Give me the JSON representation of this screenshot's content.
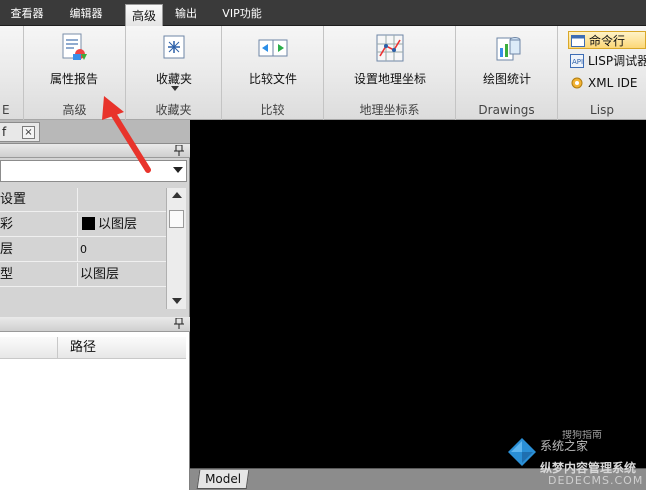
{
  "tabs": [
    {
      "label": "查看器",
      "active": false
    },
    {
      "label": "编辑器",
      "active": false
    },
    {
      "label": "高级",
      "active": true
    },
    {
      "label": "输出",
      "active": false
    },
    {
      "label": "VIP功能",
      "active": false
    }
  ],
  "ribbon": {
    "groups": [
      {
        "label": "高级",
        "buttons": [
          {
            "label": "属性报告",
            "icon": "property-report-icon"
          }
        ]
      },
      {
        "label": "收藏夹",
        "buttons": [
          {
            "label": "收藏夹",
            "icon": "favorites-icon"
          }
        ]
      },
      {
        "label": "比较",
        "buttons": [
          {
            "label": "比较文件",
            "icon": "compare-files-icon"
          }
        ]
      },
      {
        "label": "地理坐标系",
        "buttons": [
          {
            "label": "设置地理坐标",
            "icon": "geo-coordinates-icon"
          }
        ]
      },
      {
        "label": "Drawings",
        "buttons": [
          {
            "label": "绘图统计",
            "icon": "drawing-statistics-icon"
          }
        ]
      },
      {
        "label": "Lisp",
        "small_buttons": [
          {
            "label": "命令行",
            "icon": "command-line-icon",
            "highlighted": true
          },
          {
            "label": "LISP调试器",
            "icon": "lisp-debugger-icon",
            "highlighted": false
          },
          {
            "label": "XML IDE",
            "icon": "xml-ide-icon",
            "highlighted": false
          }
        ]
      }
    ],
    "left_partial_label": "E"
  },
  "document_tab": {
    "label": "f",
    "close": "×"
  },
  "properties": {
    "rows": [
      {
        "key": "设置",
        "value": ""
      },
      {
        "key": "彩",
        "value": "以图层",
        "swatch": "#000000"
      },
      {
        "key": "层",
        "value": "0"
      },
      {
        "key": "型",
        "value": "以图层"
      }
    ]
  },
  "files_panel": {
    "column_header": "路径"
  },
  "model_tab": "Model",
  "watermark": {
    "line1": "系统之家",
    "line2": "搜狗指南",
    "line3": "纵梦内容管理系统",
    "line4": "DEDECMS.COM"
  },
  "colors": {
    "annotation_arrow": "#e8332b",
    "canvas": "#000000",
    "highlight": "#fcd778"
  }
}
